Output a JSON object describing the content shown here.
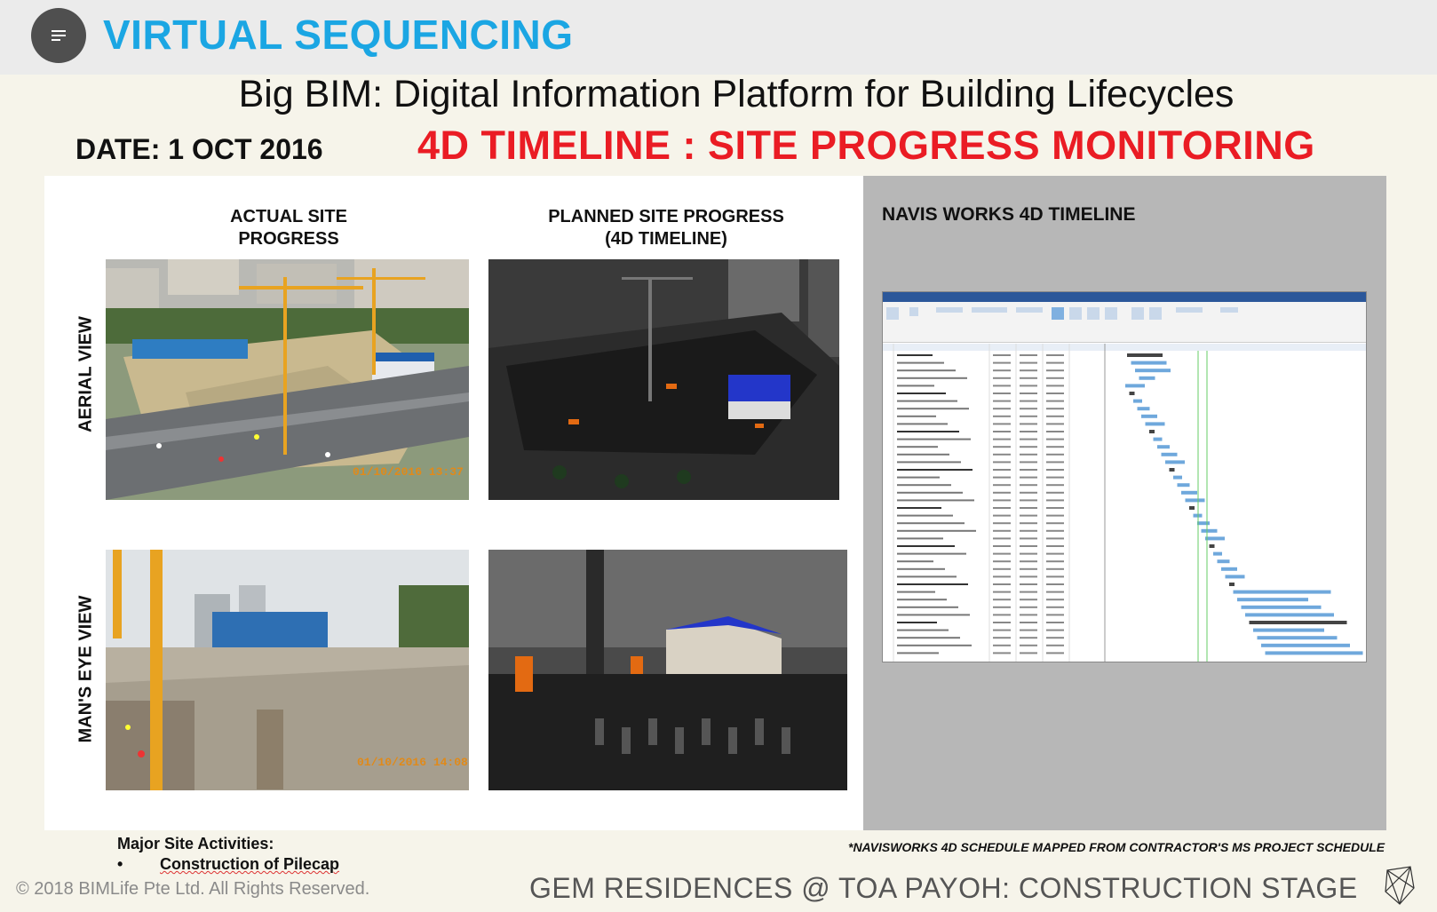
{
  "header": {
    "app_title": "VIRTUAL SEQUENCING",
    "menu_icon": "menu-icon"
  },
  "slide": {
    "main_title": "Big BIM: Digital Information Platform for Building Lifecycles",
    "date": "DATE: 1 OCT 2016",
    "subtitle": "4D TIMELINE : SITE PROGRESS MONITORING"
  },
  "columns": {
    "actual": "ACTUAL SITE PROGRESS",
    "planned_line1": "PLANNED SITE PROGRESS",
    "planned_line2": "(4D TIMELINE)",
    "navis": "NAVIS WORKS 4D TIMELINE"
  },
  "rows": {
    "aerial": "AERIAL VIEW",
    "mans_eye": "MAN'S EYE VIEW"
  },
  "photos": {
    "aerial_stamp": "01/10/2016 13:37",
    "ground_stamp": "01/10/2016 14:08"
  },
  "activities": {
    "heading": "Major Site Activities:",
    "bullet": "•",
    "item": "Construction of Pilecap"
  },
  "footnote": "*NAVISWORKS 4D SCHEDULE MAPPED FROM CONTRACTOR'S MS PROJECT SCHEDULE",
  "footer": {
    "copyright": "© 2018 BIMLife Pte Ltd. All Rights Reserved.",
    "project": "GEM RESIDENCES @ TOA PAYOH: CONSTRUCTION STAGE",
    "logo_icon": "bimlife-logo-icon"
  },
  "colors": {
    "title_blue": "#1ba6e3",
    "subtitle_red": "#ea1c24",
    "gantt_bar": "#6fa8dc"
  }
}
